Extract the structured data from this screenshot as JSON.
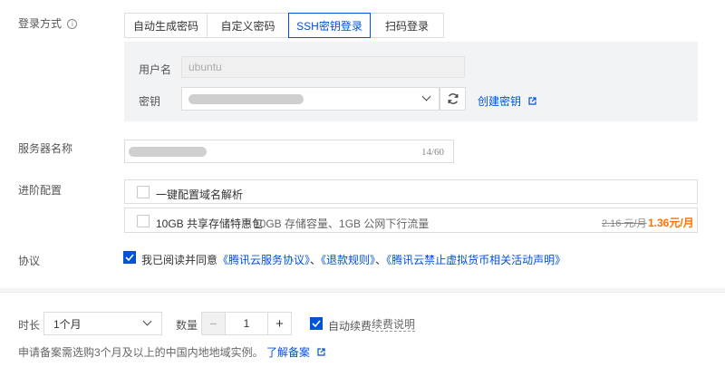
{
  "login": {
    "label": "登录方式",
    "tabs": [
      "自动生成密码",
      "自定义密码",
      "SSH密钥登录",
      "扫码登录"
    ],
    "active_tab": "SSH密钥登录",
    "username_label": "用户名",
    "username_value": "ubuntu",
    "key_label": "密钥",
    "create_key_link": "创建密钥"
  },
  "server_name": {
    "label": "服务器名称",
    "counter": "14/60"
  },
  "advanced": {
    "label": "进阶配置",
    "option1": "一键配置域名解析",
    "option2_title": "10GB 共享存储特惠包",
    "option2_desc": "10GB 存储容量、1GB 公网下行流量",
    "original_price": "2.16 元/月",
    "sale_price": "1.36元/月"
  },
  "agreement": {
    "label": "协议",
    "prefix": "我已阅读并同意",
    "link1": "《腾讯云服务协议》",
    "sep1": "、",
    "link2": "《退款规则》",
    "sep2": "、",
    "link3": "《腾讯云禁止虚拟货币相关活动声明》"
  },
  "footer": {
    "duration_label": "时长",
    "duration_value": "1个月",
    "quantity_label": "数量",
    "quantity_value": "1",
    "auto_renew_label": "自动续费",
    "renew_explain": "续费说明",
    "notice_text": "申请备案需选购3个月及以上的中国内地地域实例。",
    "notice_link": "了解备案"
  },
  "colors": {
    "accent": "#0052d9",
    "price": "#ff7200"
  }
}
